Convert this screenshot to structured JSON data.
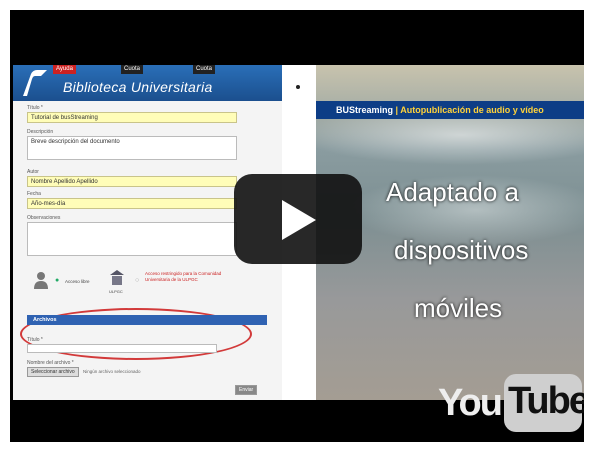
{
  "library": {
    "tabs": [
      "Ayuda",
      "Cuota",
      "Cuota"
    ],
    "title": "Biblioteca Universitaria"
  },
  "form": {
    "title_label": "Título *",
    "title_value": "Tutorial de busStreaming",
    "description_label": "Descripción",
    "description_value": "Breve descripción del documento",
    "author_label": "Autor",
    "author_value": "Nombre Apellido Apellido",
    "date_label": "Fecha",
    "date_value": "Año-mes-día",
    "observations_label": "Observaciones",
    "access_public": "Acceso libre",
    "access_restricted": "Acceso restringido para la Comunidad Universitaria de la ULPGC",
    "ulpgc": "ULPGC",
    "files_header": "Archivos",
    "file_title_label": "Título *",
    "file_name_label": "Nombre del archivo *",
    "select_file": "Seleccionar archivo",
    "no_file": "Ningún archivo seleccionado",
    "send": "Enviar"
  },
  "bus": {
    "name": "BUStreaming",
    "subtitle": "Autopublicación de audio y vídeo"
  },
  "overlay": {
    "line1": "Adaptado a",
    "line2": "dispositivos",
    "line3": "móviles"
  },
  "youtube": {
    "you": "You",
    "tube": "Tube"
  },
  "colors": {
    "header_blue": "#1b4f8e",
    "highlight_yellow": "#fffdb8",
    "oval_red": "#d23a3a",
    "bus_blue": "#0d3d86"
  }
}
